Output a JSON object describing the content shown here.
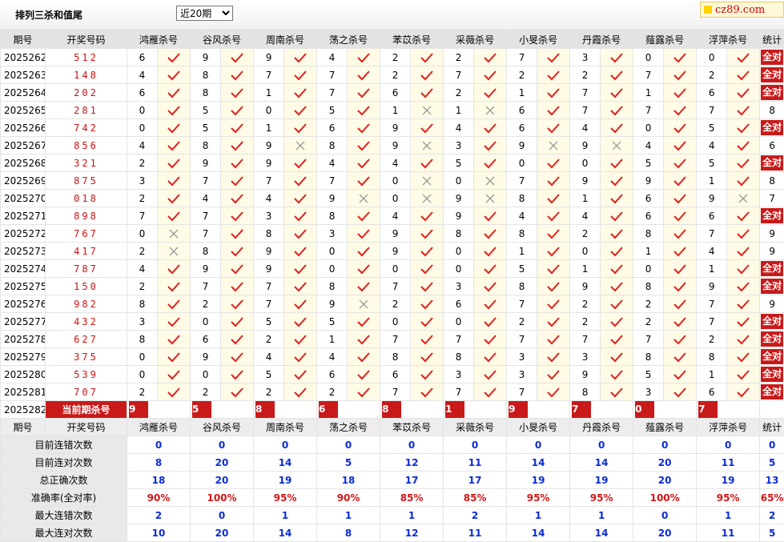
{
  "header": {
    "title": "排列三杀和值尾",
    "select_value": "近20期",
    "logo_text": "cz89.com"
  },
  "columns": {
    "issue": "期号",
    "draw": "开奖号码",
    "experts": [
      "鸿雁杀号",
      "谷风杀号",
      "周南杀号",
      "荡之杀号",
      "苯苡杀号",
      "采薇杀号",
      "小旻杀号",
      "丹霞杀号",
      "薤露杀号",
      "浮萍杀号"
    ],
    "stats": "统计"
  },
  "rows": [
    {
      "issue": "2025262",
      "draw": "512",
      "kills": [
        6,
        9,
        9,
        4,
        2,
        2,
        7,
        3,
        0,
        0
      ],
      "hits": [
        1,
        1,
        1,
        1,
        1,
        1,
        1,
        1,
        1,
        1
      ],
      "stat": "全对"
    },
    {
      "issue": "2025263",
      "draw": "148",
      "kills": [
        4,
        8,
        7,
        7,
        2,
        7,
        2,
        2,
        7,
        2
      ],
      "hits": [
        1,
        1,
        1,
        1,
        1,
        1,
        1,
        1,
        1,
        1
      ],
      "stat": "全对"
    },
    {
      "issue": "2025264",
      "draw": "202",
      "kills": [
        6,
        8,
        1,
        7,
        6,
        2,
        1,
        7,
        1,
        6
      ],
      "hits": [
        1,
        1,
        1,
        1,
        1,
        1,
        1,
        1,
        1,
        1
      ],
      "stat": "全对"
    },
    {
      "issue": "2025265",
      "draw": "281",
      "kills": [
        0,
        5,
        0,
        5,
        1,
        1,
        6,
        7,
        7,
        7
      ],
      "hits": [
        1,
        1,
        1,
        1,
        0,
        0,
        1,
        1,
        1,
        1
      ],
      "stat": "8"
    },
    {
      "issue": "2025266",
      "draw": "742",
      "kills": [
        0,
        5,
        1,
        6,
        9,
        4,
        6,
        4,
        0,
        5
      ],
      "hits": [
        1,
        1,
        1,
        1,
        1,
        1,
        1,
        1,
        1,
        1
      ],
      "stat": "全对"
    },
    {
      "issue": "2025267",
      "draw": "856",
      "kills": [
        4,
        8,
        9,
        8,
        9,
        3,
        9,
        9,
        4,
        4
      ],
      "hits": [
        1,
        1,
        0,
        1,
        0,
        1,
        0,
        0,
        1,
        1
      ],
      "stat": "6"
    },
    {
      "issue": "2025268",
      "draw": "321",
      "kills": [
        2,
        9,
        9,
        4,
        4,
        5,
        0,
        0,
        5,
        5
      ],
      "hits": [
        1,
        1,
        1,
        1,
        1,
        1,
        1,
        1,
        1,
        1
      ],
      "stat": "全对"
    },
    {
      "issue": "2025269",
      "draw": "875",
      "kills": [
        3,
        7,
        7,
        7,
        0,
        0,
        7,
        9,
        9,
        1
      ],
      "hits": [
        1,
        1,
        1,
        1,
        0,
        0,
        1,
        1,
        1,
        1
      ],
      "stat": "8"
    },
    {
      "issue": "2025270",
      "draw": "018",
      "kills": [
        2,
        4,
        4,
        9,
        0,
        9,
        8,
        1,
        6,
        9
      ],
      "hits": [
        1,
        1,
        1,
        0,
        0,
        0,
        1,
        1,
        1,
        0
      ],
      "stat": "7"
    },
    {
      "issue": "2025271",
      "draw": "898",
      "kills": [
        7,
        7,
        3,
        8,
        4,
        9,
        4,
        4,
        6,
        6
      ],
      "hits": [
        1,
        1,
        1,
        1,
        1,
        1,
        1,
        1,
        1,
        1
      ],
      "stat": "全对"
    },
    {
      "issue": "2025272",
      "draw": "767",
      "kills": [
        0,
        7,
        8,
        3,
        9,
        8,
        8,
        2,
        8,
        7
      ],
      "hits": [
        0,
        1,
        1,
        1,
        1,
        1,
        1,
        1,
        1,
        1
      ],
      "stat": "9"
    },
    {
      "issue": "2025273",
      "draw": "417",
      "kills": [
        2,
        8,
        9,
        0,
        9,
        0,
        1,
        0,
        1,
        4
      ],
      "hits": [
        0,
        1,
        1,
        1,
        1,
        1,
        1,
        1,
        1,
        1
      ],
      "stat": "9"
    },
    {
      "issue": "2025274",
      "draw": "787",
      "kills": [
        4,
        9,
        9,
        0,
        0,
        0,
        5,
        1,
        0,
        1
      ],
      "hits": [
        1,
        1,
        1,
        1,
        1,
        1,
        1,
        1,
        1,
        1
      ],
      "stat": "全对"
    },
    {
      "issue": "2025275",
      "draw": "150",
      "kills": [
        2,
        7,
        7,
        8,
        7,
        3,
        8,
        9,
        8,
        9
      ],
      "hits": [
        1,
        1,
        1,
        1,
        1,
        1,
        1,
        1,
        1,
        1
      ],
      "stat": "全对"
    },
    {
      "issue": "2025276",
      "draw": "982",
      "kills": [
        8,
        2,
        7,
        9,
        2,
        6,
        7,
        2,
        2,
        7
      ],
      "hits": [
        1,
        1,
        1,
        0,
        1,
        1,
        1,
        1,
        1,
        1
      ],
      "stat": "9"
    },
    {
      "issue": "2025277",
      "draw": "432",
      "kills": [
        3,
        0,
        5,
        5,
        0,
        0,
        2,
        2,
        2,
        7
      ],
      "hits": [
        1,
        1,
        1,
        1,
        1,
        1,
        1,
        1,
        1,
        1
      ],
      "stat": "全对"
    },
    {
      "issue": "2025278",
      "draw": "627",
      "kills": [
        8,
        6,
        2,
        1,
        7,
        7,
        7,
        7,
        7,
        2
      ],
      "hits": [
        1,
        1,
        1,
        1,
        1,
        1,
        1,
        1,
        1,
        1
      ],
      "stat": "全对"
    },
    {
      "issue": "2025279",
      "draw": "375",
      "kills": [
        0,
        9,
        4,
        4,
        8,
        8,
        3,
        3,
        8,
        8
      ],
      "hits": [
        1,
        1,
        1,
        1,
        1,
        1,
        1,
        1,
        1,
        1
      ],
      "stat": "全对"
    },
    {
      "issue": "2025280",
      "draw": "539",
      "kills": [
        0,
        0,
        5,
        6,
        6,
        3,
        3,
        9,
        5,
        1
      ],
      "hits": [
        1,
        1,
        1,
        1,
        1,
        1,
        1,
        1,
        1,
        1
      ],
      "stat": "全对"
    },
    {
      "issue": "2025281",
      "draw": "707",
      "kills": [
        2,
        2,
        2,
        2,
        7,
        7,
        7,
        8,
        3,
        6
      ],
      "hits": [
        1,
        1,
        1,
        1,
        1,
        1,
        1,
        1,
        1,
        1
      ],
      "stat": "全对"
    }
  ],
  "current": {
    "issue": "2025282",
    "label": "当前期杀号",
    "kills": [
      9,
      5,
      8,
      6,
      8,
      1,
      9,
      7,
      0,
      7
    ]
  },
  "summary": [
    {
      "label": "目前连错次数",
      "values": [
        "0",
        "0",
        "0",
        "0",
        "0",
        "0",
        "0",
        "0",
        "0",
        "0",
        "0"
      ],
      "color": "blue"
    },
    {
      "label": "目前连对次数",
      "values": [
        "8",
        "20",
        "14",
        "5",
        "12",
        "11",
        "14",
        "14",
        "20",
        "11",
        "5"
      ],
      "color": "blue"
    },
    {
      "label": "总正确次数",
      "values": [
        "18",
        "20",
        "19",
        "18",
        "17",
        "17",
        "19",
        "19",
        "20",
        "19",
        "13"
      ],
      "color": "blue"
    },
    {
      "label": "准确率(全对率)",
      "values": [
        "90%",
        "100%",
        "95%",
        "90%",
        "85%",
        "85%",
        "95%",
        "95%",
        "100%",
        "95%",
        "65%"
      ],
      "color": "red"
    },
    {
      "label": "最大连错次数",
      "values": [
        "2",
        "0",
        "1",
        "1",
        "1",
        "2",
        "1",
        "1",
        "0",
        "1",
        "2"
      ],
      "color": "blue"
    },
    {
      "label": "最大连对次数",
      "values": [
        "10",
        "20",
        "14",
        "8",
        "12",
        "11",
        "14",
        "14",
        "20",
        "11",
        "5"
      ],
      "color": "blue"
    }
  ],
  "icons": {
    "hit": "check-icon",
    "miss": "cross-icon"
  },
  "colors": {
    "accent_red": "#c91a1a",
    "blue": "#0a2bd6",
    "mark_bg": "#fffbe6"
  }
}
